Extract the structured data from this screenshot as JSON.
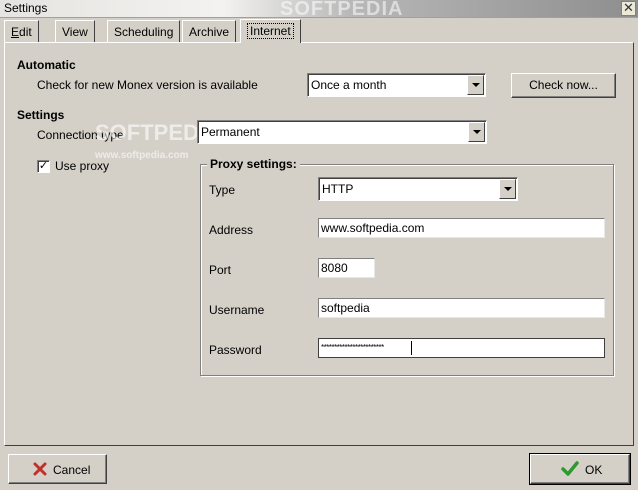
{
  "window": {
    "title": "Settings",
    "close_glyph": "✕",
    "watermark": "SOFTPEDIA"
  },
  "tabs": [
    {
      "label": "Edit"
    },
    {
      "label": "View"
    },
    {
      "label": "Scheduling"
    },
    {
      "label": "Archive"
    },
    {
      "label": "Internet",
      "active": true
    }
  ],
  "automatic": {
    "heading": "Automatic",
    "check_label": "Check for new Monex version is available",
    "frequency_value": "Once a month",
    "check_now_button": "Check now..."
  },
  "settings": {
    "heading": "Settings",
    "connection_type_label": "Connection type",
    "connection_type_value": "Permanent",
    "use_proxy_label": "Use proxy",
    "use_proxy_checked": true,
    "watermark_small": "SOFTPEDIA",
    "watermark_url": "www.softpedia.com"
  },
  "proxy": {
    "group_title": "Proxy settings:",
    "type_label": "Type",
    "type_value": "HTTP",
    "address_label": "Address",
    "address_value": "www.softpedia.com",
    "port_label": "Port",
    "port_value": "8080",
    "username_label": "Username",
    "username_value": "softpedia",
    "password_label": "Password",
    "password_value": "************************"
  },
  "footer": {
    "cancel_button": "Cancel",
    "ok_button": "OK"
  },
  "icons": {
    "cancel": "x-icon",
    "ok": "checkmark-icon",
    "cancel_color": "#c0302a",
    "ok_color": "#2e9a2e"
  }
}
